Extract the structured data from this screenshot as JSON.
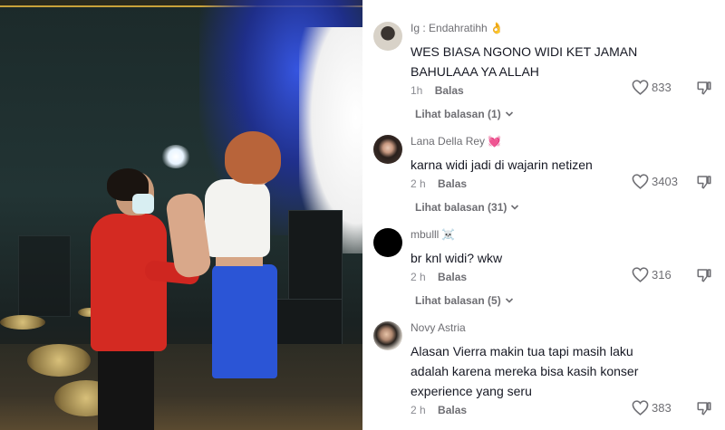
{
  "comments": [
    {
      "username": "Ig : Endahratihh",
      "user_emoji": "👌",
      "avatar_color": "#d8d2c8",
      "text": "WES BIASA NGONO WIDI KET JAMAN BAHULAAA YA ALLAH",
      "time": "1h",
      "reply_label": "Balas",
      "likes": "833",
      "view_replies": "Lihat balasan (1)"
    },
    {
      "username": "Lana Della Rey",
      "user_emoji": "💓",
      "avatar_color": "#3a2e2a",
      "text": "karna widi jadi di wajarin netizen",
      "time": "2 h",
      "reply_label": "Balas",
      "likes": "3403",
      "view_replies": "Lihat balasan (31)"
    },
    {
      "username": "mbulll",
      "user_emoji": "☠️",
      "avatar_color": "#000000",
      "text": "br knl widi? wkw",
      "time": "2 h",
      "reply_label": "Balas",
      "likes": "316",
      "view_replies": "Lihat balasan (5)"
    },
    {
      "username": "Novy Astria",
      "user_emoji": "",
      "avatar_color": "#b9b2aa",
      "text": "Alasan Vierra makin tua tapi masih laku adalah karena mereka bisa kasih konser experience yang seru",
      "time": "2 h",
      "reply_label": "Balas",
      "likes": "383",
      "view_replies": ""
    }
  ],
  "colors": {
    "text_primary": "#161823",
    "text_secondary": "#6e6e73",
    "video_shirt_red": "#d42a22",
    "video_pants_blue": "#2b55d6"
  },
  "icons": {
    "like": "heart-outline-icon",
    "dislike": "thumbs-down-icon",
    "expand": "chevron-down-icon"
  }
}
